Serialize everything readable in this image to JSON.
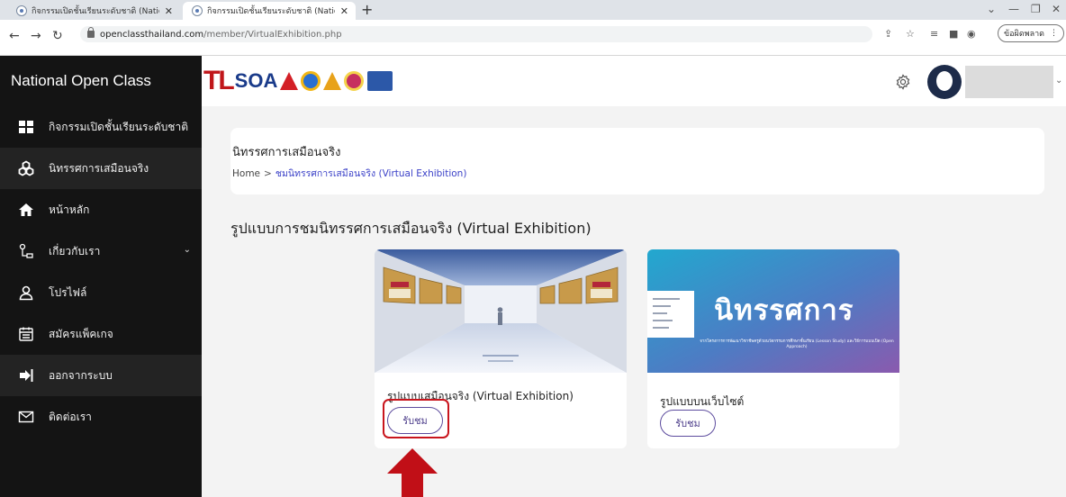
{
  "browser": {
    "tabs": [
      {
        "title": "กิจกรรมเปิดชั้นเรียนระดับชาติ (Nation"
      },
      {
        "title": "กิจกรรมเปิดชั้นเรียนระดับชาติ (Nation"
      }
    ],
    "url_host": "openclassthailand.com",
    "url_path": "/member/VirtualExhibition.php",
    "update_label": "ข้อผิดพลาด"
  },
  "sidebar": {
    "brand": "National Open Class",
    "items": [
      {
        "label": "กิจกรรมเปิดชั้นเรียนระดับชาติ",
        "icon": "grid-icon"
      },
      {
        "label": "นิทรรศการเสมือนจริง",
        "icon": "cubes-icon",
        "active": true
      },
      {
        "label": "หน้าหลัก",
        "icon": "home-icon"
      },
      {
        "label": "เกี่ยวกับเรา",
        "icon": "org-icon",
        "has_submenu": true
      },
      {
        "label": "โปรไฟล์",
        "icon": "user-icon"
      },
      {
        "label": "สมัครแพ็คเกจ",
        "icon": "calendar-icon"
      },
      {
        "label": "ออกจากระบบ",
        "icon": "logout-icon",
        "active": true
      },
      {
        "label": "ติดต่อเรา",
        "icon": "mail-icon"
      }
    ]
  },
  "header": {
    "logo_text_tl": "TL",
    "logo_text_soa": "SOA"
  },
  "breadcrumb": {
    "title": "นิทรรศการเสมือนจริง",
    "home": "Home",
    "separator": ">",
    "current": "ชมนิทรรศการเสมือนจริง (Virtual Exhibition)"
  },
  "section": {
    "heading": "รูปแบบการชมนิทรรศการเสมือนจริง (Virtual Exhibition)"
  },
  "cards": [
    {
      "title": "รูปแบบเสมือนจริง (Virtual Exhibition)",
      "button": "รับชม"
    },
    {
      "title": "รูปแบบบนเว็บไซต์",
      "button": "รับชม",
      "banner_title": "นิทรรศการ",
      "banner_subtitle": "จากโครงการการพัฒนาวิชาชีพครูด้วยนวัตกรรมการศึกษาชั้นเรียน (Lesson Study) และวิธีการแบบเปิด (Open Approach)"
    }
  ],
  "colors": {
    "sidebar_bg": "#141414",
    "accent_purple": "#4c3d8a",
    "highlight_red": "#c9151d",
    "breadcrumb_link": "#3c42c8"
  }
}
